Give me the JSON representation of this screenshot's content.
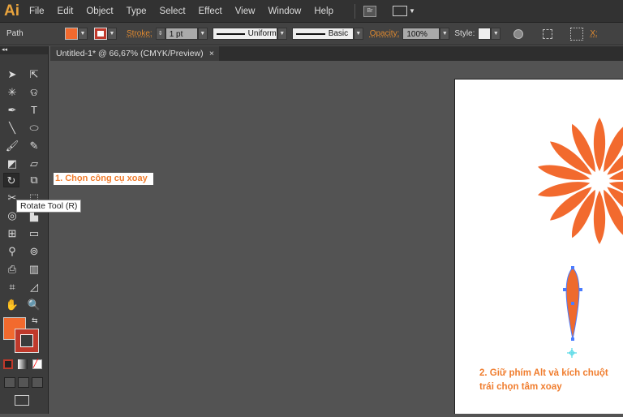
{
  "app": {
    "logo": "Ai",
    "menu": [
      "File",
      "Edit",
      "Object",
      "Type",
      "Select",
      "Effect",
      "View",
      "Window",
      "Help"
    ],
    "bridge": "Br"
  },
  "control": {
    "selection": "Path",
    "fill_color": "#f26a2e",
    "stroke_label": "Stroke:",
    "stroke_weight": "1 pt",
    "profile": "Uniform",
    "brush": "Basic",
    "opacity_label": "Opacity:",
    "opacity": "100%",
    "style_label": "Style:",
    "x_label": "X:"
  },
  "document": {
    "tab": "Untitled-1* @ 66,67% (CMYK/Preview)",
    "close": "×"
  },
  "tooltip": "Rotate Tool (R)",
  "annotations": {
    "step1": "1. Chọn công cụ xoay",
    "step2": "2. Giữ phím Alt và kích chuột trái chọn tâm xoay"
  },
  "colors": {
    "accent": "#f26a2e",
    "annotation": "#f07d2e",
    "selection": "#4a7cff"
  }
}
